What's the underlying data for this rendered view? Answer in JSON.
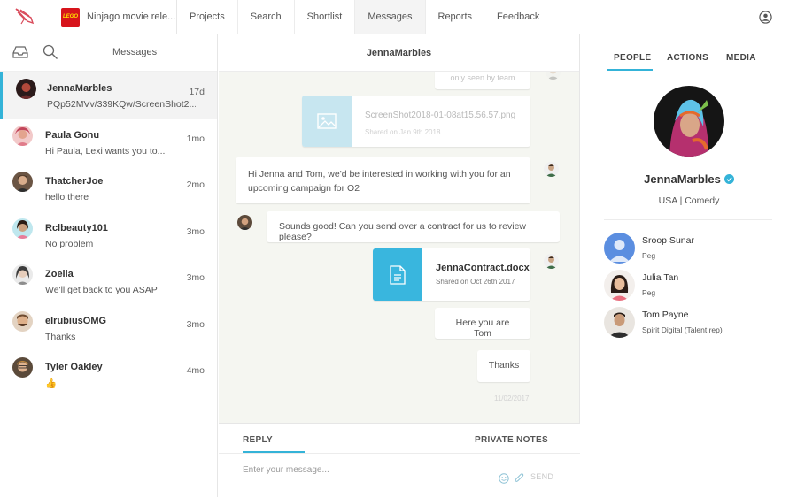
{
  "topbar": {
    "campaign_name": "Ninjago movie rele...",
    "nav": [
      "Projects",
      "Search",
      "Shortlist",
      "Messages",
      "Reports",
      "Feedback"
    ],
    "active_nav": "Messages"
  },
  "left": {
    "title": "Messages",
    "conversations": [
      {
        "name": "JennaMarbles",
        "snippet": "PQp52MVv/339KQw/ScreenShot2...",
        "time": "17d"
      },
      {
        "name": "Paula Gonu",
        "snippet": "Hi Paula, Lexi wants you to...",
        "time": "1mo"
      },
      {
        "name": "ThatcherJoe",
        "snippet": "hello there",
        "time": "2mo"
      },
      {
        "name": "Rclbeauty101",
        "snippet": "No problem",
        "time": "3mo"
      },
      {
        "name": "Zoella",
        "snippet": "We'll get back to you ASAP",
        "time": "3mo"
      },
      {
        "name": "elrubiusOMG",
        "snippet": "Thanks",
        "time": "3mo"
      },
      {
        "name": "Tyler Oakley",
        "snippet": "👍",
        "time": "4mo"
      }
    ]
  },
  "chat": {
    "title": "JennaMarbles",
    "seen_note": "only seen by team",
    "screenshot_file": {
      "name": "ScreenShot2018-01-08at15.56.57.png",
      "meta": "Shared on Jan 9th 2018"
    },
    "msg1": "Hi Jenna and Tom, we'd be interested in working with you for an upcoming campaign for O2",
    "msg2": "Sounds good! Can you send over a contract for us to review please?",
    "contract_file": {
      "name": "JennaContract.docx",
      "meta": "Shared on Oct 26th 2017"
    },
    "msg3": "Here you are Tom",
    "msg4": "Thanks",
    "date": "11/02/2017",
    "composer": {
      "reply_tab": "REPLY",
      "notes_tab": "PRIVATE NOTES",
      "placeholder": "Enter your message...",
      "send_label": "SEND"
    }
  },
  "right": {
    "tabs": [
      "PEOPLE",
      "ACTIONS",
      "MEDIA"
    ],
    "profile": {
      "name": "JennaMarbles",
      "meta": "USA | Comedy"
    },
    "people": [
      {
        "name": "Sroop Sunar",
        "role": "Peg"
      },
      {
        "name": "Julia Tan",
        "role": "Peg"
      },
      {
        "name": "Tom Payne",
        "role": "Spirit Digital (Talent rep)"
      }
    ]
  },
  "colors": {
    "accent": "#34b3d8",
    "chat_bg": "#f5f6f1",
    "lego_red": "#d7141b"
  },
  "icons": [
    "rocket-icon",
    "user-circle-icon",
    "inbox-icon",
    "search-icon",
    "image-icon",
    "document-icon",
    "emoji-icon",
    "paperclip-icon",
    "verified-icon"
  ]
}
